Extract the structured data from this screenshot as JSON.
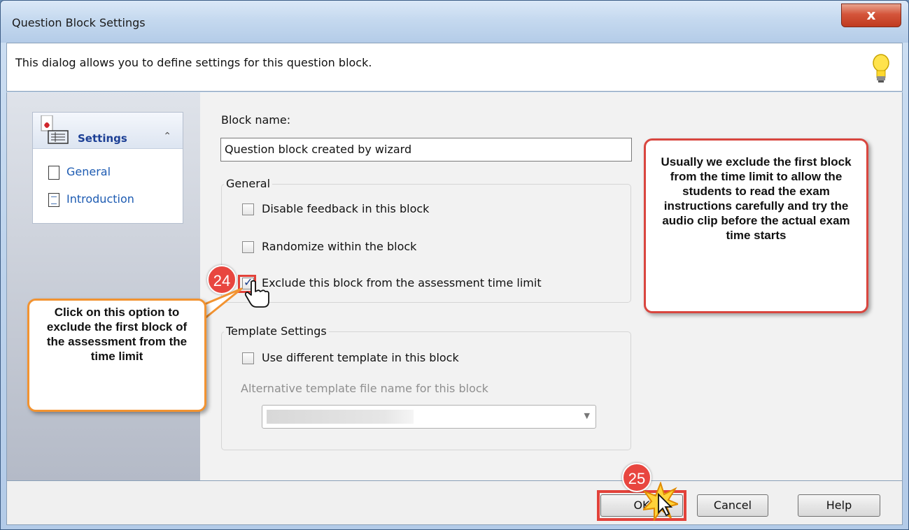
{
  "window": {
    "title": "Question Block Settings",
    "close_label": "x"
  },
  "header": {
    "description": "This dialog allows you to define settings for this question block."
  },
  "sidebar": {
    "section_label": "Settings",
    "items": [
      {
        "label": "General"
      },
      {
        "label": "Introduction"
      }
    ]
  },
  "form": {
    "block_name_label": "Block name:",
    "block_name_value": "Question block created by wizard",
    "general_group_label": "General",
    "general_options": [
      {
        "label": "Disable feedback in this block",
        "checked": false
      },
      {
        "label": "Randomize within the block",
        "checked": false
      },
      {
        "label": "Exclude this block from the assessment time limit",
        "checked": true
      }
    ],
    "template_group_label": "Template Settings",
    "template_option": {
      "label": "Use different template in this block",
      "checked": false
    },
    "alt_template_label": "Alternative template file name for this block"
  },
  "footer": {
    "ok_label": "OK",
    "cancel_label": "Cancel",
    "help_label": "Help"
  },
  "annotations": {
    "right_callout": "Usually we exclude the first block from the time limit to allow the students to read the exam instructions carefully and try the audio clip before the actual exam time starts",
    "left_callout": "Click on this option to exclude the first block of the assessment from the time limit",
    "step_24": "24",
    "step_25": "25"
  },
  "colors": {
    "callout_red": "#d9463f",
    "callout_orange": "#f29331",
    "nav_link": "#1d5bb2"
  }
}
